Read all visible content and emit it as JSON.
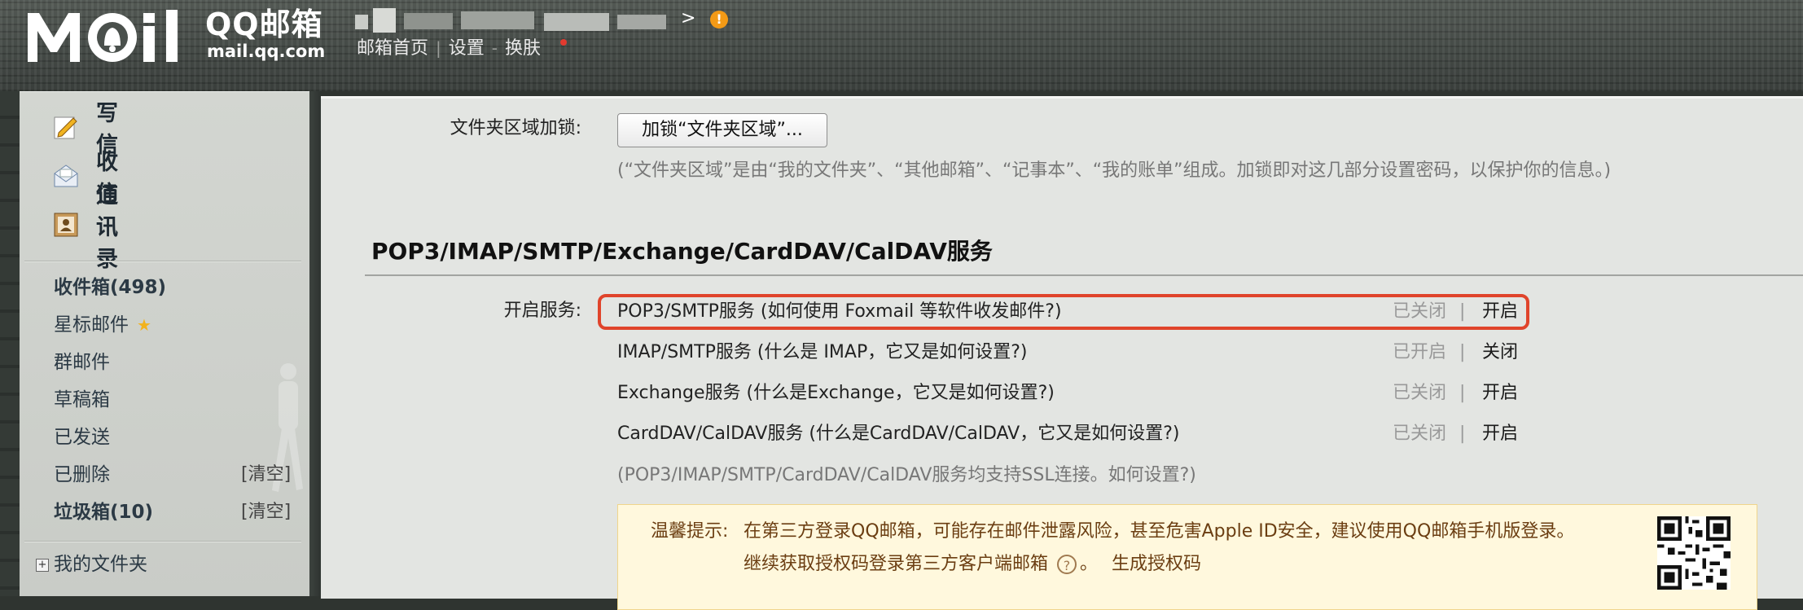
{
  "header": {
    "brand": "QQ邮箱",
    "domain": "mail.qq.com",
    "nav": [
      "邮箱首页",
      "设置",
      "换肤"
    ],
    "account_arrow": ">",
    "warn_mark": "!"
  },
  "sidebar": {
    "quick": [
      {
        "label": "写信",
        "icon": "compose-icon"
      },
      {
        "label": "收信",
        "icon": "inbox-icon"
      },
      {
        "label": "通讯录",
        "icon": "contacts-icon"
      }
    ],
    "folders": [
      {
        "label": "收件箱(498)",
        "bold": true
      },
      {
        "label": "星标邮件",
        "bold": false
      },
      {
        "label": "群邮件",
        "bold": false
      },
      {
        "label": "草稿箱",
        "bold": false
      },
      {
        "label": "已发送",
        "bold": false
      },
      {
        "label": "已删除",
        "bold": false,
        "action": "[清空]"
      },
      {
        "label": "垃圾箱(10)",
        "bold": true,
        "action": "[清空]"
      }
    ],
    "my_folders": "我的文件夹",
    "expand_mark": "+",
    "star_glyph": "★"
  },
  "content": {
    "lock_label": "文件夹区域加锁:",
    "lock_button": "加锁“文件夹区域”...",
    "lock_note": "(“文件夹区域”是由“我的文件夹”、“其他邮箱”、“记事本”、“我的账单”组成。加锁即对这几部分设置密码，以保护你的信息。)",
    "section_title": "POP3/IMAP/SMTP/Exchange/CardDAV/CalDAV服务",
    "service_label": "开启服务:",
    "services": [
      {
        "name": "POP3/SMTP服务 (如何使用 Foxmail 等软件收发邮件?)",
        "status": "已关闭",
        "action": "开启"
      },
      {
        "name": "IMAP/SMTP服务 (什么是 IMAP，它又是如何设置?)",
        "status": "已开启",
        "action": "关闭"
      },
      {
        "name": "Exchange服务 (什么是Exchange，它又是如何设置?)",
        "status": "已关闭",
        "action": "开启"
      },
      {
        "name": "CardDAV/CalDAV服务 (什么是CardDAV/CalDAV，它又是如何设置?)",
        "status": "已关闭",
        "action": "开启"
      }
    ],
    "pipe": "|",
    "ssl_note": "(POP3/IMAP/SMTP/CardDAV/CalDAV服务均支持SSL连接。如何设置?)",
    "tip": {
      "label": "温馨提示:",
      "line1": "在第三方登录QQ邮箱，可能存在邮件泄露风险，甚至危害Apple ID安全，建议使用QQ邮箱手机版登录。",
      "line2_prefix": "继续获取授权码登录第三方客户端邮箱",
      "help_glyph": "?",
      "line2_dot": "。",
      "generate_code": "生成授权码"
    }
  }
}
